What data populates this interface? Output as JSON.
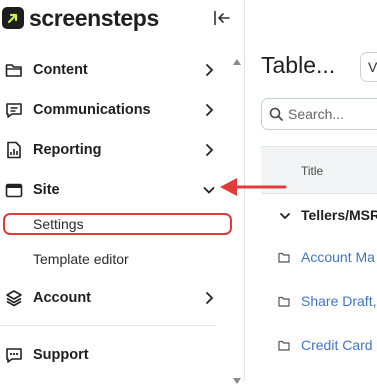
{
  "brand": {
    "name": "screensteps"
  },
  "sidebar": {
    "items": [
      {
        "label": "Content",
        "icon": "folder-icon"
      },
      {
        "label": "Communications",
        "icon": "chat-icon"
      },
      {
        "label": "Reporting",
        "icon": "report-icon"
      },
      {
        "label": "Site",
        "icon": "browser-window-icon",
        "expanded": true
      },
      {
        "label": "Account",
        "icon": "layers-icon"
      },
      {
        "label": "Support",
        "icon": "support-chat-icon"
      }
    ],
    "site_subitems": [
      {
        "label": "Settings",
        "highlighted": true
      },
      {
        "label": "Template editor"
      }
    ]
  },
  "main": {
    "title": "Table...",
    "top_button_label": "V",
    "search_placeholder": "Search...",
    "table": {
      "column_header": "Title",
      "group": "Tellers/MSRs",
      "rows": [
        "Account Ma",
        "Share Draft,",
        "Credit Card"
      ]
    }
  },
  "colors": {
    "annotation": "#e23b3b",
    "link": "#3f76c4",
    "text": "#1f1f1f"
  }
}
